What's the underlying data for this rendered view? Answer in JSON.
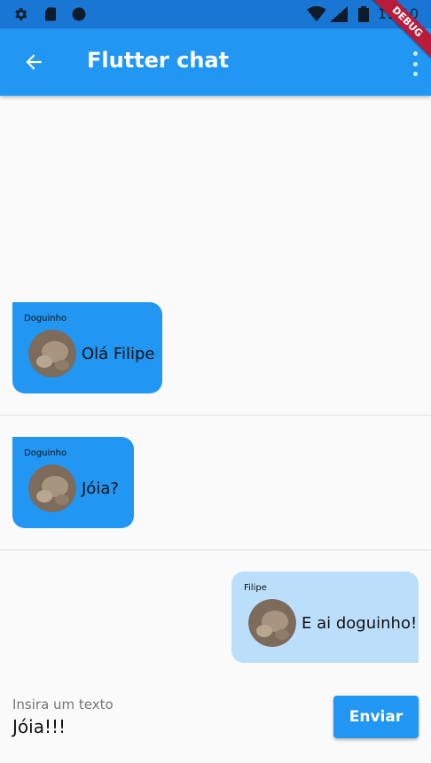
{
  "app": {
    "title": "Flutter chat",
    "debug_label": "DEBUG",
    "accent_color": "#2196f3",
    "status_bar_color": "#1976d2"
  },
  "status_bar": {
    "time": "11:10",
    "icons": [
      "gear-icon",
      "sd-card-icon",
      "circle-icon",
      "wifi-icon",
      "signal-icon",
      "battery-icon"
    ]
  },
  "messages": [
    {
      "sender": "Doguinho",
      "text": "Olá Filipe",
      "side": "left"
    },
    {
      "sender": "Doguinho",
      "text": "Jóia?",
      "side": "left"
    },
    {
      "sender": "Filipe",
      "text": "E ai doguinho!",
      "side": "right"
    }
  ],
  "composer": {
    "label": "Insira um texto",
    "value": "Jóia!!!",
    "send_label": "Enviar"
  }
}
